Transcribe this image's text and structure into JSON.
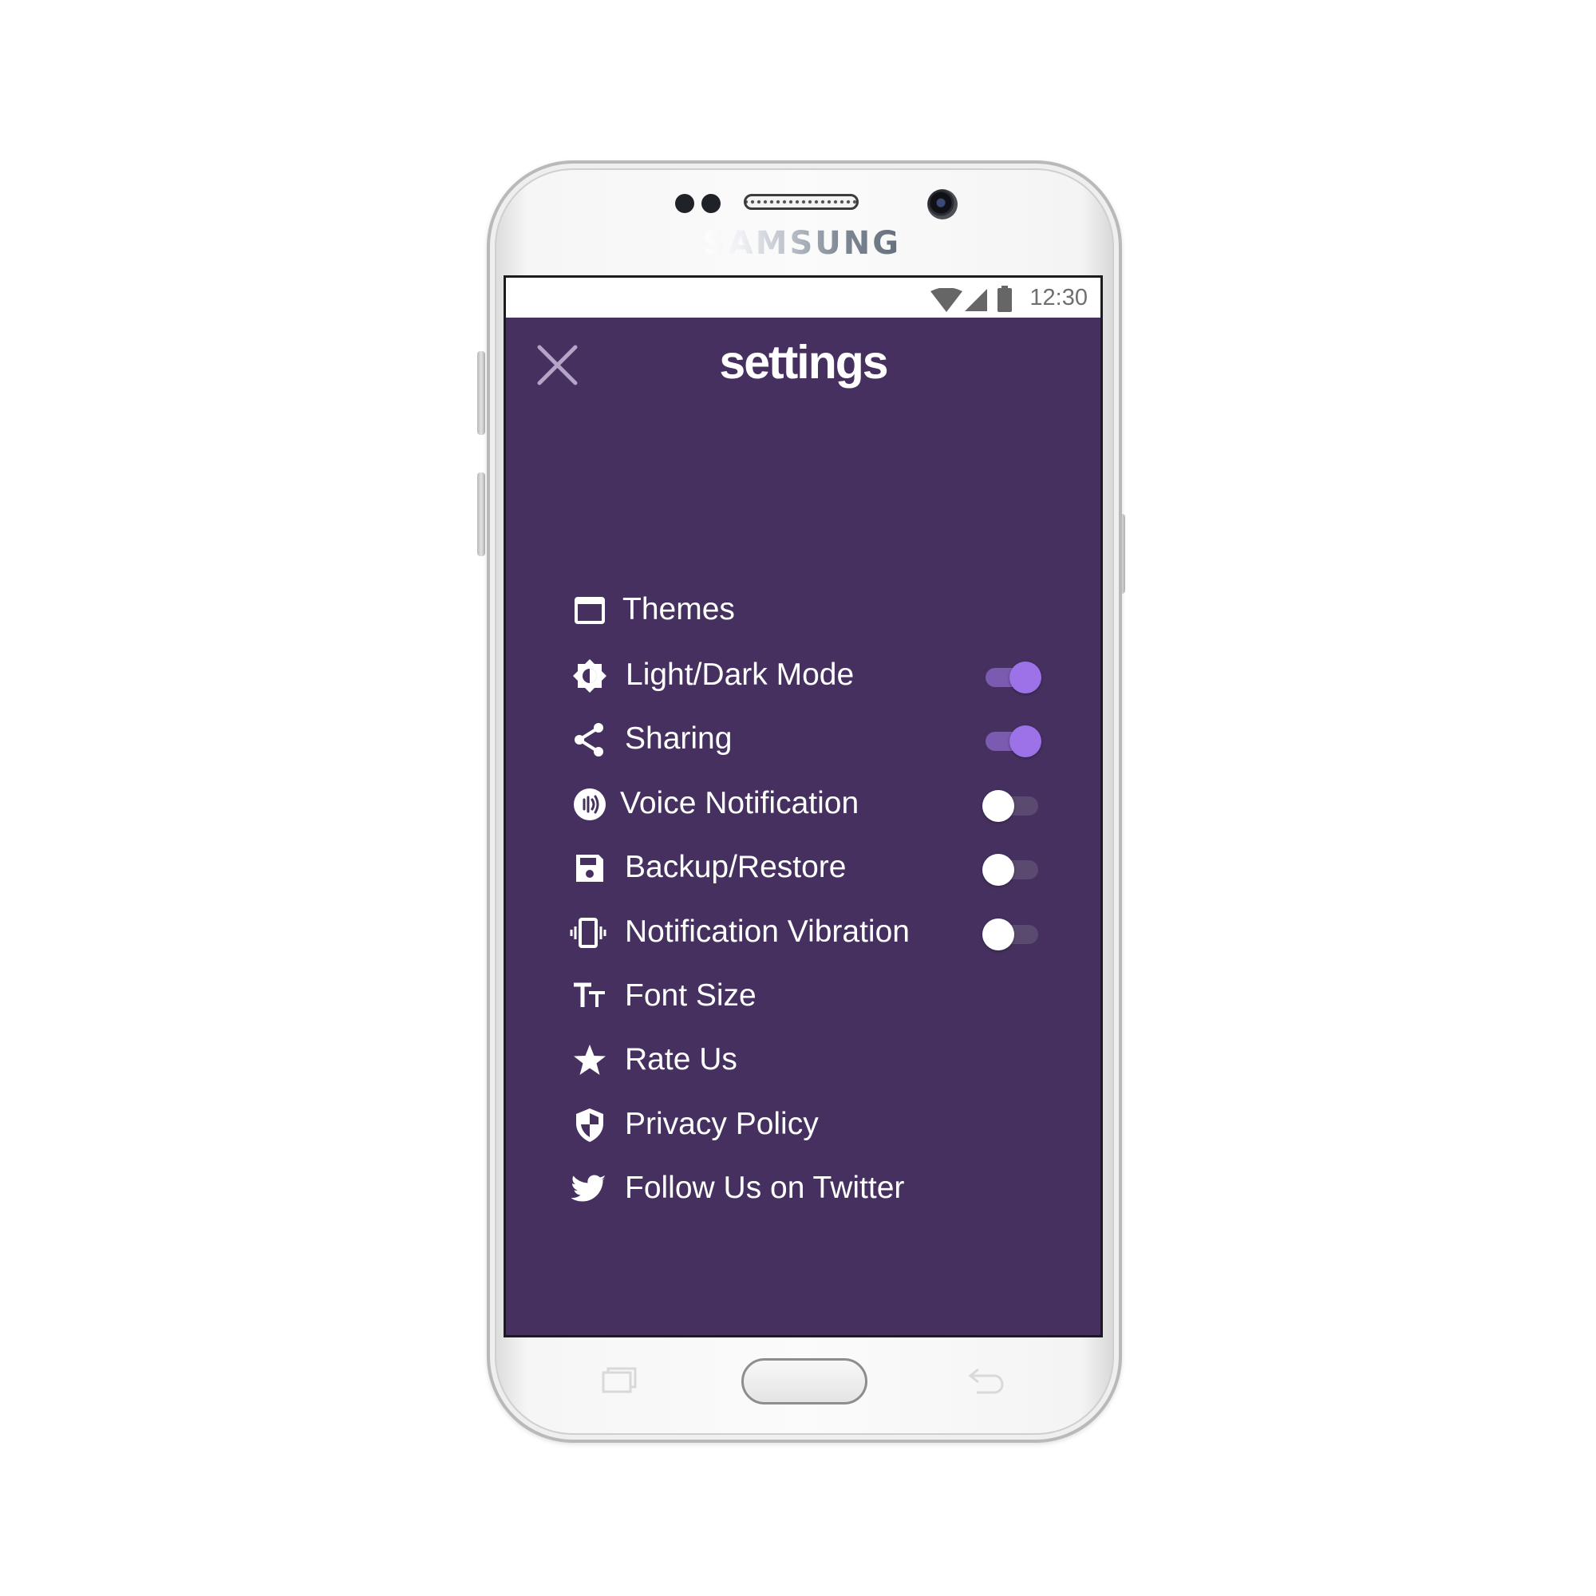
{
  "device": {
    "brand": "SAMSUNG"
  },
  "status_bar": {
    "time": "12:30",
    "icons": [
      "wifi-icon",
      "cell-signal-icon",
      "battery-icon"
    ]
  },
  "app_bar": {
    "title": "settings",
    "close_icon": "close-icon"
  },
  "theme_colors": {
    "background": "#45305f",
    "toggle_on": "#9d71e8",
    "toggle_off_thumb": "#ffffff",
    "text": "#ffffff"
  },
  "menu": {
    "items": [
      {
        "label": "Themes",
        "icon": "window-icon"
      },
      {
        "label": "Light/Dark Mode",
        "icon": "brightness-icon",
        "toggle": true
      },
      {
        "label": "Sharing",
        "icon": "share-icon",
        "toggle": true
      },
      {
        "label": "Voice Notification",
        "icon": "voice-icon",
        "toggle": false
      },
      {
        "label": "Backup/Restore",
        "icon": "save-icon",
        "toggle": false
      },
      {
        "label": "Notification Vibration",
        "icon": "vibration-icon",
        "toggle": false
      },
      {
        "label": "Font Size",
        "icon": "text-size-icon"
      },
      {
        "label": "Rate Us",
        "icon": "star-icon"
      },
      {
        "label": "Privacy Policy",
        "icon": "shield-icon"
      },
      {
        "label": "Follow Us on Twitter",
        "icon": "twitter-icon"
      }
    ]
  }
}
